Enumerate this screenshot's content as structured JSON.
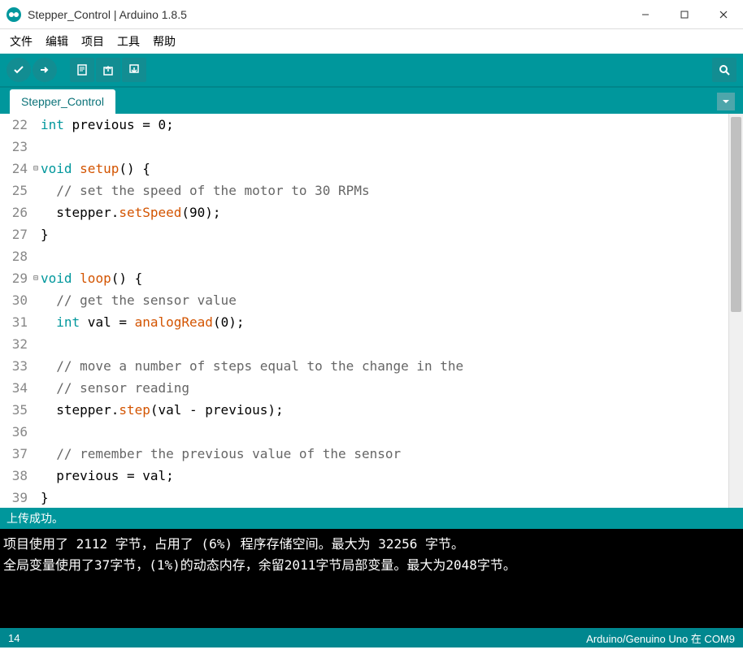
{
  "window": {
    "title": "Stepper_Control | Arduino 1.8.5"
  },
  "menu": {
    "file": "文件",
    "edit": "编辑",
    "project": "项目",
    "tools": "工具",
    "help": "帮助"
  },
  "tab": {
    "name": "Stepper_Control"
  },
  "code": {
    "lines": [
      {
        "n": 22,
        "fold": "",
        "html": "<span class='type'>int</span> previous = 0;"
      },
      {
        "n": 23,
        "fold": "",
        "html": ""
      },
      {
        "n": 24,
        "fold": "⊟",
        "html": "<span class='kw'>void</span> <span class='func'>setup</span>() {"
      },
      {
        "n": 25,
        "fold": "",
        "html": "  <span class='cmt'>// set the speed of the motor to 30 RPMs</span>"
      },
      {
        "n": 26,
        "fold": "",
        "html": "  stepper.<span class='func'>setSpeed</span>(90);"
      },
      {
        "n": 27,
        "fold": "",
        "html": "}"
      },
      {
        "n": 28,
        "fold": "",
        "html": ""
      },
      {
        "n": 29,
        "fold": "⊟",
        "html": "<span class='kw'>void</span> <span class='func'>loop</span>() {"
      },
      {
        "n": 30,
        "fold": "",
        "html": "  <span class='cmt'>// get the sensor value</span>"
      },
      {
        "n": 31,
        "fold": "",
        "html": "  <span class='type'>int</span> val = <span class='func'>analogRead</span>(0);"
      },
      {
        "n": 32,
        "fold": "",
        "html": ""
      },
      {
        "n": 33,
        "fold": "",
        "html": "  <span class='cmt'>// move a number of steps equal to the change in the</span>"
      },
      {
        "n": 34,
        "fold": "",
        "html": "  <span class='cmt'>// sensor reading</span>"
      },
      {
        "n": 35,
        "fold": "",
        "html": "  stepper.<span class='func'>step</span>(val - previous);"
      },
      {
        "n": 36,
        "fold": "",
        "html": ""
      },
      {
        "n": 37,
        "fold": "",
        "html": "  <span class='cmt'>// remember the previous value of the sensor</span>"
      },
      {
        "n": 38,
        "fold": "",
        "html": "  previous = val;"
      },
      {
        "n": 39,
        "fold": "",
        "html": "}"
      }
    ]
  },
  "status": {
    "message": "上传成功。"
  },
  "console": {
    "line1": "项目使用了 2112 字节，占用了 (6%) 程序存储空间。最大为 32256 字节。",
    "line2": "全局变量使用了37字节，(1%)的动态内存，余留2011字节局部变量。最大为2048字节。"
  },
  "bottom": {
    "left": "14",
    "right": "Arduino/Genuino Uno 在 COM9"
  }
}
